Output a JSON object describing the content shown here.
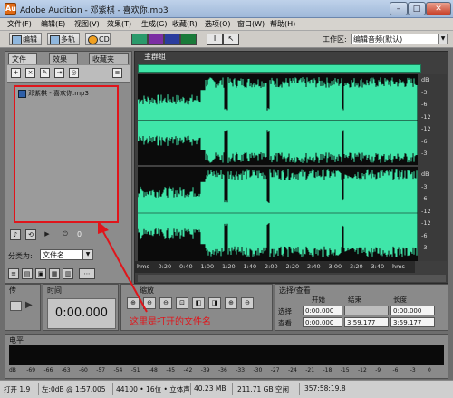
{
  "window": {
    "app_icon": "Au",
    "title": "Adobe Audition - 邓紫棋 - 喜欢你.mp3",
    "min_glyph": "–",
    "max_glyph": "□",
    "close_glyph": "✕"
  },
  "menu": [
    "文件(F)",
    "编辑(E)",
    "视图(V)",
    "效果(T)",
    "生成(G)",
    "收藏(R)",
    "选项(O)",
    "窗口(W)",
    "帮助(H)"
  ],
  "toolbar": {
    "edit_label": "编辑",
    "multitrack_label": "多轨",
    "cd_label": "CD",
    "workspace_label": "工作区:",
    "workspace_value": "编辑音频(默认)"
  },
  "files_panel": {
    "tabs": [
      "文件",
      "效果",
      "收藏夹"
    ],
    "file_name": "邓紫棋 - 喜欢你.mp3",
    "counter": "0",
    "sort_label": "分类为:",
    "sort_value": "文件名",
    "highlight_color": "#e0151b"
  },
  "main_panel": {
    "tab": "主群组",
    "waveform_color": "#3fe6a9",
    "time_ticks": [
      "hms",
      "0:20",
      "0:40",
      "1:00",
      "1:20",
      "1:40",
      "2:00",
      "2:20",
      "2:40",
      "3:00",
      "3:20",
      "3:40",
      "hms"
    ],
    "db_ticks_upper": [
      "dB",
      "-3",
      "-6",
      "-12",
      "-12",
      "-6",
      "-3"
    ],
    "db_ticks_lower": [
      "dB",
      "-3",
      "-6",
      "-12",
      "-12",
      "-6",
      "-3"
    ]
  },
  "transport_panel": {
    "title": "传"
  },
  "time_panel": {
    "title": "时间",
    "time": "0:00.000"
  },
  "zoom_panel": {
    "title": "缩放"
  },
  "selection_panel": {
    "title": "选择/查看",
    "headers": [
      "开始",
      "结束",
      "长度"
    ],
    "rows": [
      {
        "label": "选择",
        "start": "0:00.000",
        "end": "",
        "length": "0:00.000"
      },
      {
        "label": "查看",
        "start": "0:00.000",
        "end": "3:59.177",
        "length": "3:59.177"
      }
    ]
  },
  "level_panel": {
    "title": "电平",
    "scale": [
      "dB",
      "-69",
      "-66",
      "-63",
      "-60",
      "-57",
      "-54",
      "-51",
      "-48",
      "-45",
      "-42",
      "-39",
      "-36",
      "-33",
      "-30",
      "-27",
      "-24",
      "-21",
      "-18",
      "-15",
      "-12",
      "-9",
      "-6",
      "-3",
      "0"
    ]
  },
  "statusbar": {
    "open_time": "打开 1.9",
    "left_level": "左:0dB @ 1:57.005",
    "format": "44100 • 16位 • 立体声",
    "size": "40.23 MB",
    "free": "211.71 GB 空闲",
    "remaining": "357:58:19.8"
  },
  "annotation": "这里是打开的文件名"
}
